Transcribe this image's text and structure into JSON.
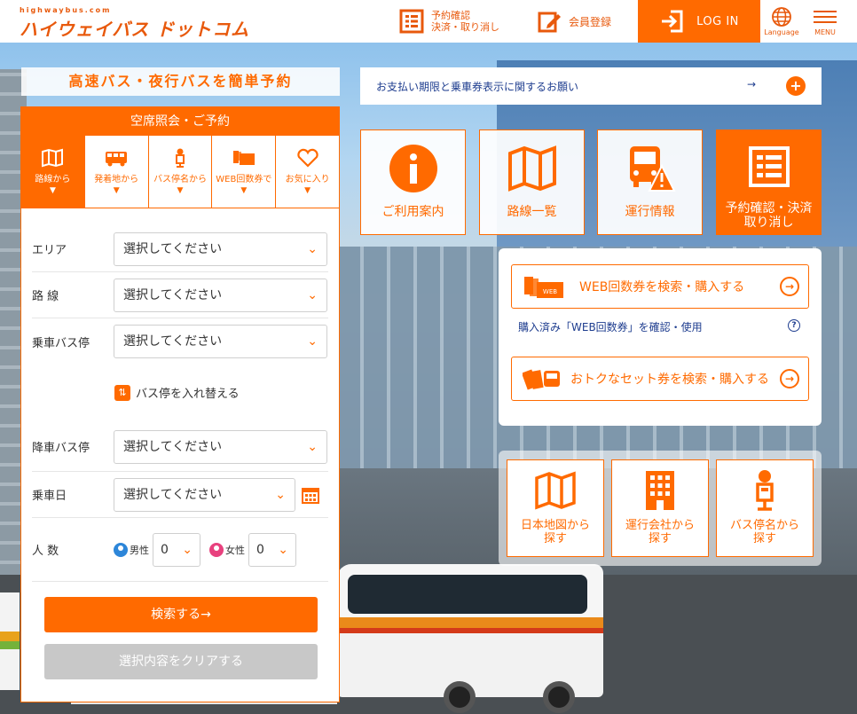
{
  "header": {
    "logo_small": "highwaybus.com",
    "logo_main": "ハイウェイバス ドットコム",
    "reserve_line1": "予約確認",
    "reserve_line2": "決済・取り消し",
    "member": "会員登録",
    "login": "LOG IN",
    "language": "Language",
    "menu": "MENU"
  },
  "tagline": "高速バス・夜行バスを簡単予約",
  "search": {
    "title": "空席照会・ご予約",
    "tabs": [
      {
        "label": "路線から",
        "icon": "map-icon",
        "active": true
      },
      {
        "label": "発着地から",
        "icon": "bus-icon",
        "active": false
      },
      {
        "label": "バス停名から",
        "icon": "bus-stop-icon",
        "active": false
      },
      {
        "label": "WEB回数券で",
        "icon": "ticket-icon",
        "active": false
      },
      {
        "label": "お気に入り",
        "icon": "heart-icon",
        "active": false
      }
    ],
    "fields": {
      "area_label": "エリア",
      "area_value": "選択してください",
      "route_label": "路 線",
      "route_value": "選択してください",
      "board_label": "乗車バス停",
      "board_value": "選択してください",
      "swap": "バス停を入れ替える",
      "alight_label": "降車バス停",
      "alight_value": "選択してください",
      "date_label": "乗車日",
      "date_value": "選択してください",
      "people_label": "人 数",
      "male_label": "男性",
      "male_value": "0",
      "female_label": "女性",
      "female_value": "0"
    },
    "search_button": "検索する→",
    "clear_button": "選択内容をクリアする"
  },
  "notice": {
    "text": "お支払い期限と乗車券表示に関するお願い",
    "arrow": "→",
    "plus": "+"
  },
  "tiles": [
    {
      "label": "ご利用案内",
      "icon": "info-icon"
    },
    {
      "label": "路線一覧",
      "icon": "map-icon"
    },
    {
      "label": "運行情報",
      "icon": "bus-warning-icon"
    },
    {
      "label": "予約確認・決済取り消し",
      "icon": "list-icon"
    }
  ],
  "ticket": {
    "web_button": "WEB回数券を検索・購入する",
    "link": "購入済み「WEB回数券」を確認・使用",
    "set_button": "おトクなセット券を検索・購入する"
  },
  "find": [
    {
      "label_line1": "日本地図から",
      "label_line2": "探す",
      "icon": "map-icon"
    },
    {
      "label_line1": "運行会社から",
      "label_line2": "探す",
      "icon": "building-icon"
    },
    {
      "label_line1": "バス停名から",
      "label_line2": "探す",
      "icon": "bus-stop-icon"
    }
  ],
  "colors": {
    "accent": "#ff6a00",
    "link": "#1e3d8f",
    "clear": "#c8c8c8"
  }
}
